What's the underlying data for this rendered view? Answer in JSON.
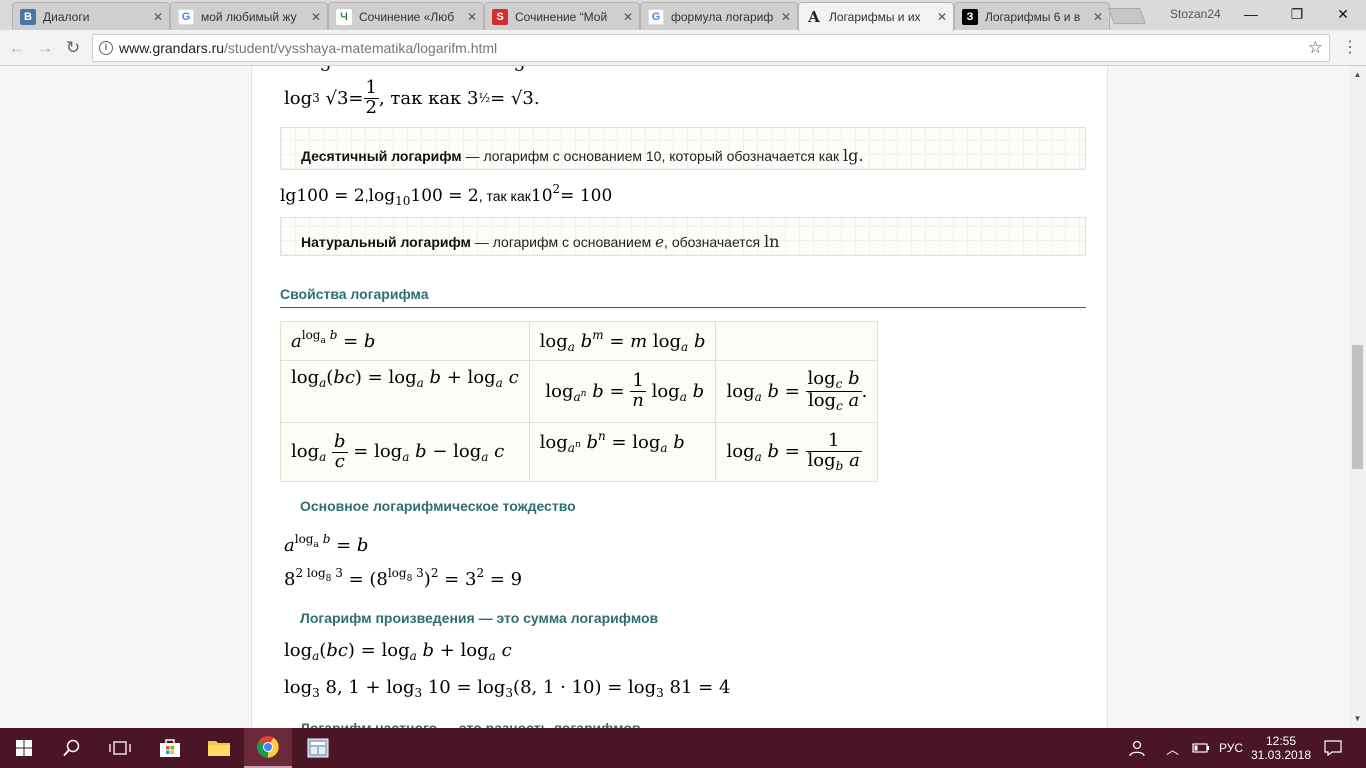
{
  "browser": {
    "tabs": [
      {
        "title": "Диалоги",
        "icon": "vk-icon",
        "color": "#4a76a8",
        "glyph": "В"
      },
      {
        "title": "мой любимый жу",
        "icon": "google-icon",
        "color": "#4285f4",
        "glyph": "G"
      },
      {
        "title": "Сочинение «Люб",
        "icon": "leaf-icon",
        "color": "#3a8a3a",
        "glyph": "Ч"
      },
      {
        "title": "Сочинение “Мой",
        "icon": "s-logo-icon",
        "color": "#d32f2f",
        "glyph": "S"
      },
      {
        "title": "формула логариф",
        "icon": "google-icon",
        "color": "#4285f4",
        "glyph": "G"
      },
      {
        "title": "Логарифмы и их",
        "icon": "grandars-icon",
        "color": "#222222",
        "glyph": "A"
      },
      {
        "title": "Логарифмы 6 и в",
        "icon": "znanija-icon",
        "color": "#000000",
        "glyph": "З"
      }
    ],
    "profile": "Stozan24",
    "close_glyph": "✕",
    "url_domain": "www.grandars.ru",
    "url_path": "/student/vysshaya-matematika/logarifm.html",
    "window_controls": {
      "minimize": "—",
      "maximize": "❐",
      "close": "✕"
    }
  },
  "content": {
    "top_line": {
      "lhs": "log",
      "base": "3",
      "rad": "√3",
      "eq": " = ",
      "num": "1",
      "den": "2",
      "tail": ", так как 3",
      "exp": "½",
      "tail2": " = √3."
    },
    "decimal": {
      "term": "Десятичный логарифм",
      "text": " — логарифм с основанием 10, который обозначается как ",
      "sym": "lg."
    },
    "decimal_example": {
      "a": "lg100 = 2",
      "b": ", ",
      "c": "log",
      "c_sub": "10",
      "d": "100 = 2",
      "e": ", так как ",
      "f": "10",
      "f_sup": "2",
      "g": " = 100"
    },
    "natural": {
      "term": "Натуральный логарифм",
      "text": " — логарифм с основанием ",
      "e": "e",
      "text2": ", обозначается ",
      "sym": "ln"
    },
    "section_title": "Свойства логарифма",
    "sub1": "Основное логарифмическое тождество",
    "sub2": "Логарифм произведения — это сумма логарифмов",
    "sub3": "Логарифм частного — это разность логарифмов"
  },
  "taskbar": {
    "lang": "РУС",
    "time": "12:55",
    "date": "31.03.2018"
  },
  "colors": {
    "accent": "#2f6f6f",
    "taskbar": "#4a1524"
  }
}
